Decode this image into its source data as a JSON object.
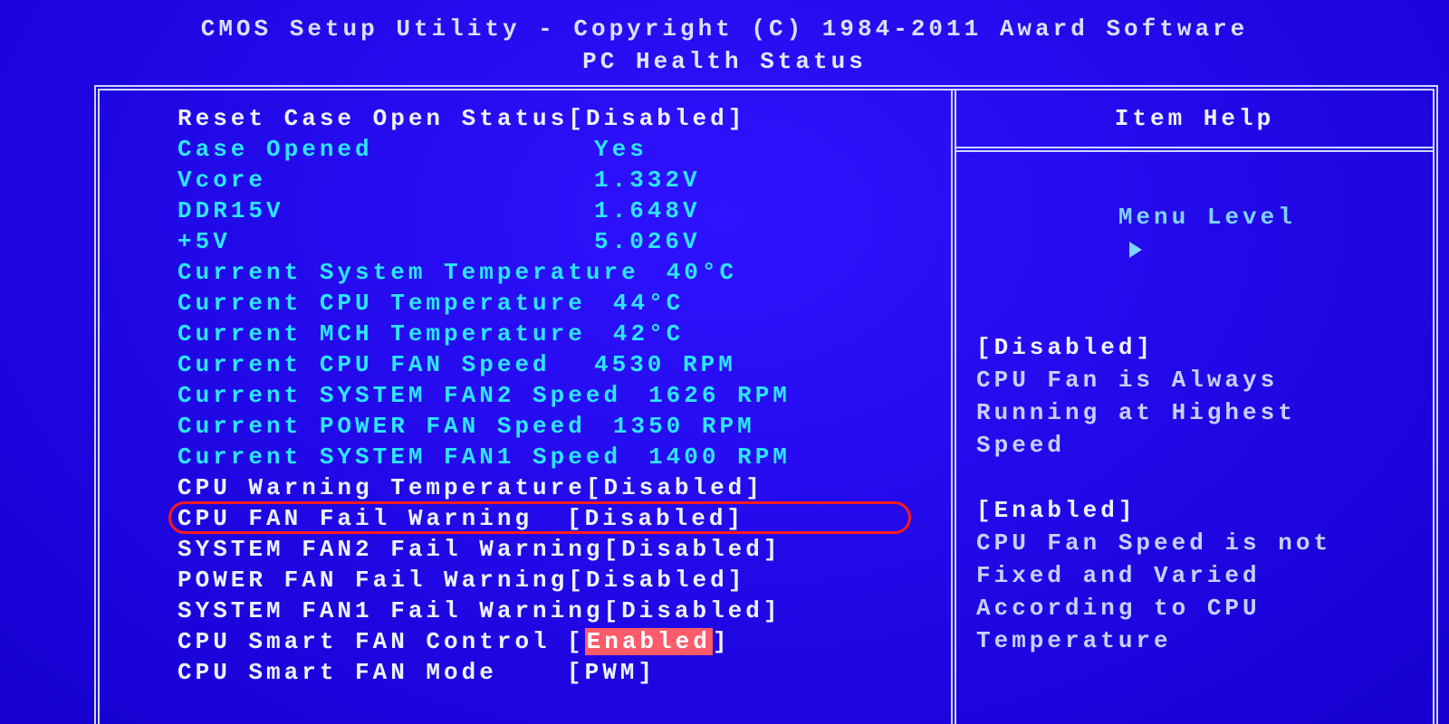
{
  "header": {
    "title": "CMOS Setup Utility - Copyright (C) 1984-2011 Award Software",
    "subtitle": "PC Health Status"
  },
  "settings": [
    {
      "key": "reset_case_open",
      "label": "Reset Case Open Status",
      "value": "[Disabled]",
      "editable": true
    },
    {
      "key": "case_opened",
      "label": "Case Opened",
      "value": "Yes",
      "editable": false
    },
    {
      "key": "vcore",
      "label": "Vcore",
      "value": "1.332V",
      "editable": false
    },
    {
      "key": "ddr15v",
      "label": "DDR15V",
      "value": "1.648V",
      "editable": false
    },
    {
      "key": "plus5v",
      "label": "+5V",
      "value": "5.026V",
      "editable": false
    },
    {
      "key": "sys_temp",
      "label": "Current System Temperature",
      "value": "40°C",
      "editable": false
    },
    {
      "key": "cpu_temp",
      "label": "Current CPU Temperature",
      "value": "44°C",
      "editable": false
    },
    {
      "key": "mch_temp",
      "label": "Current MCH Temperature",
      "value": "42°C",
      "editable": false
    },
    {
      "key": "cpu_fan",
      "label": "Current CPU FAN Speed",
      "value": "4530 RPM",
      "editable": false
    },
    {
      "key": "sys_fan2",
      "label": "Current SYSTEM FAN2 Speed",
      "value": "1626 RPM",
      "editable": false
    },
    {
      "key": "power_fan",
      "label": "Current POWER FAN Speed",
      "value": "1350 RPM",
      "editable": false
    },
    {
      "key": "sys_fan1",
      "label": "Current SYSTEM FAN1 Speed",
      "value": "1400 RPM",
      "editable": false
    },
    {
      "key": "cpu_warn_temp",
      "label": "CPU Warning Temperature",
      "value": "[Disabled]",
      "editable": true
    },
    {
      "key": "cpu_fan_fail",
      "label": "CPU FAN Fail Warning",
      "value": "[Disabled]",
      "editable": true,
      "ring": true
    },
    {
      "key": "sys_fan2_fail",
      "label": "SYSTEM FAN2 Fail Warning",
      "value": "[Disabled]",
      "editable": true
    },
    {
      "key": "power_fan_fail",
      "label": "POWER FAN Fail Warning",
      "value": "[Disabled]",
      "editable": true
    },
    {
      "key": "sys_fan1_fail",
      "label": "SYSTEM FAN1 Fail Warning",
      "value": "[Disabled]",
      "editable": true
    },
    {
      "key": "cpu_smart_ctrl",
      "label": "CPU Smart FAN Control",
      "value": "[Enabled]",
      "editable": true,
      "selected": true
    },
    {
      "key": "cpu_smart_mode",
      "label": "CPU Smart FAN Mode",
      "value": "[PWM]",
      "editable": true
    }
  ],
  "help": {
    "title": "Item Help",
    "menu_level": "Menu Level",
    "sections": [
      {
        "heading": "[Disabled]",
        "body": "CPU Fan is Always Running at Highest Speed"
      },
      {
        "heading": "[Enabled]",
        "body": "CPU Fan Speed is not Fixed and Varied According to CPU Temperature"
      }
    ]
  }
}
